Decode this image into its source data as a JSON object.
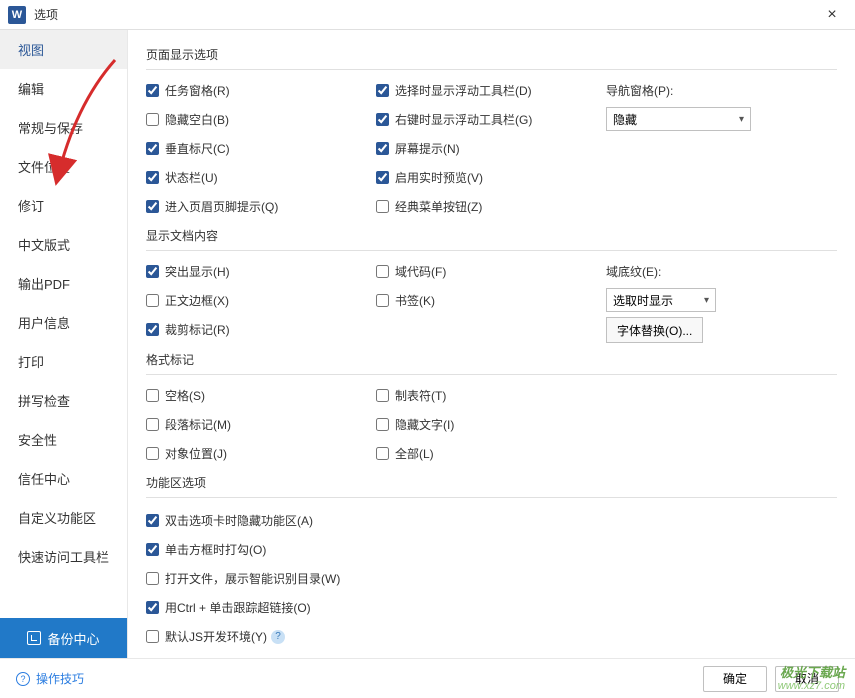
{
  "titlebar": {
    "app_letter": "W",
    "title": "选项",
    "close": "×"
  },
  "sidebar": {
    "items": [
      {
        "label": "视图",
        "active": true
      },
      {
        "label": "编辑"
      },
      {
        "label": "常规与保存"
      },
      {
        "label": "文件位置"
      },
      {
        "label": "修订"
      },
      {
        "label": "中文版式"
      },
      {
        "label": "输出PDF"
      },
      {
        "label": "用户信息"
      },
      {
        "label": "打印"
      },
      {
        "label": "拼写检查"
      },
      {
        "label": "安全性"
      },
      {
        "label": "信任中心"
      },
      {
        "label": "自定义功能区"
      },
      {
        "label": "快速访问工具栏"
      }
    ],
    "backup": "备份中心"
  },
  "sections": {
    "page_display": {
      "title": "页面显示选项",
      "left": [
        {
          "label": "任务窗格(R)",
          "checked": true
        },
        {
          "label": "隐藏空白(B)",
          "checked": false
        },
        {
          "label": "垂直标尺(C)",
          "checked": true
        },
        {
          "label": "状态栏(U)",
          "checked": true
        },
        {
          "label": "进入页眉页脚提示(Q)",
          "checked": true
        }
      ],
      "mid": [
        {
          "label": "选择时显示浮动工具栏(D)",
          "checked": true
        },
        {
          "label": "右键时显示浮动工具栏(G)",
          "checked": true
        },
        {
          "label": "屏幕提示(N)",
          "checked": true
        },
        {
          "label": "启用实时预览(V)",
          "checked": true
        },
        {
          "label": "经典菜单按钮(Z)",
          "checked": false
        }
      ],
      "right": {
        "nav_label": "导航窗格(P):",
        "nav_value": "隐藏"
      }
    },
    "doc_content": {
      "title": "显示文档内容",
      "left": [
        {
          "label": "突出显示(H)",
          "checked": true
        },
        {
          "label": "正文边框(X)",
          "checked": false
        },
        {
          "label": "裁剪标记(R)",
          "checked": true
        }
      ],
      "mid": [
        {
          "label": "域代码(F)",
          "checked": false
        },
        {
          "label": "书签(K)",
          "checked": false
        }
      ],
      "right": {
        "shade_label": "域底纹(E):",
        "shade_value": "选取时显示",
        "font_btn": "字体替换(O)..."
      }
    },
    "format_marks": {
      "title": "格式标记",
      "left": [
        {
          "label": "空格(S)",
          "checked": false
        },
        {
          "label": "段落标记(M)",
          "checked": false
        },
        {
          "label": "对象位置(J)",
          "checked": false
        }
      ],
      "mid": [
        {
          "label": "制表符(T)",
          "checked": false
        },
        {
          "label": "隐藏文字(I)",
          "checked": false
        },
        {
          "label": "全部(L)",
          "checked": false
        }
      ]
    },
    "ribbon": {
      "title": "功能区选项",
      "items": [
        {
          "label": "双击选项卡时隐藏功能区(A)",
          "checked": true
        },
        {
          "label": "单击方框时打勾(O)",
          "checked": true
        },
        {
          "label": "打开文件，展示智能识别目录(W)",
          "checked": false
        },
        {
          "label": "用Ctrl + 单击跟踪超链接(O)",
          "checked": true
        },
        {
          "label": "默认JS开发环境(Y)",
          "checked": false,
          "help": true
        }
      ]
    }
  },
  "footer": {
    "tips": "操作技巧",
    "ok": "确定",
    "cancel": "取消"
  },
  "watermark": {
    "line1": "极光下载站",
    "line2": "www.xz7.com"
  }
}
